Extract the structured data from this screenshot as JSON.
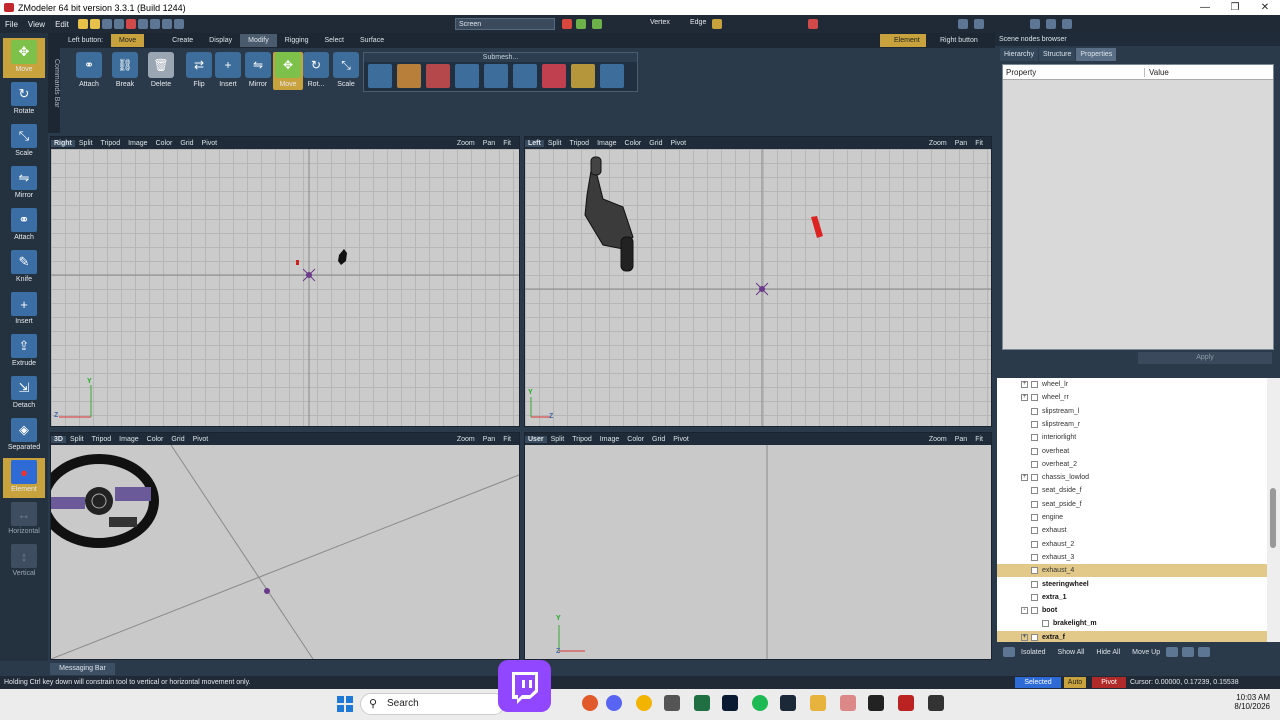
{
  "window": {
    "title": "ZModeler 64 bit version 3.3.1 (Build 1244)"
  },
  "menu": [
    "File",
    "View",
    "Edit"
  ],
  "toolbar": {
    "screen_dropdown": "Screen",
    "vertex": "Vertex",
    "edge": "Edge",
    "left_button_label": "Left button:",
    "left_button_value": "Move",
    "element_label": "Element",
    "right_button_label": "Right button"
  },
  "left_tools": [
    {
      "label": "Move",
      "icon": "move-icon",
      "active": true
    },
    {
      "label": "Rotate",
      "icon": "rotate-icon"
    },
    {
      "label": "Scale",
      "icon": "scale-icon"
    },
    {
      "label": "Mirror",
      "icon": "mirror-icon"
    },
    {
      "label": "Attach",
      "icon": "attach-icon"
    },
    {
      "label": "Knife",
      "icon": "knife-icon"
    },
    {
      "label": "Insert",
      "icon": "insert-icon"
    },
    {
      "label": "Extrude",
      "icon": "extrude-icon"
    },
    {
      "label": "Detach",
      "icon": "detach-icon"
    },
    {
      "label": "Separated",
      "icon": "separated-icon"
    },
    {
      "label": "Element",
      "icon": "element-icon",
      "active": true
    },
    {
      "label": "Horizontal",
      "icon": "horizontal-icon",
      "disabled": true
    },
    {
      "label": "Vertical",
      "icon": "vertical-icon",
      "disabled": true
    }
  ],
  "commands_bar": "Commands Bar",
  "ribbon_tabs": [
    "Create",
    "Display",
    "Modify",
    "Rigging",
    "Select",
    "Surface"
  ],
  "ribbon_active_tab": "Modify",
  "ribbon_buttons": [
    {
      "label": "Attach",
      "icon": "attach-icon"
    },
    {
      "label": "Break",
      "icon": "break-icon"
    },
    {
      "label": "Delete",
      "icon": "trash-icon"
    },
    {
      "label": "Flip",
      "icon": "flip-icon"
    },
    {
      "label": "Insert",
      "icon": "insert-icon"
    },
    {
      "label": "Mirror",
      "icon": "mirror-icon"
    },
    {
      "label": "Move",
      "icon": "move-icon",
      "active": true
    },
    {
      "label": "Rot...",
      "icon": "rotate-icon"
    },
    {
      "label": "Scale",
      "icon": "scale-icon"
    }
  ],
  "submesh_title": "Submesh...",
  "viewports": [
    {
      "name": "Right",
      "menu": [
        "Split",
        "Tripod",
        "Image",
        "Color",
        "Grid",
        "Pivot"
      ],
      "right": [
        "Zoom",
        "Pan",
        "Fit"
      ],
      "axes": [
        "Y",
        "Z"
      ]
    },
    {
      "name": "Left",
      "menu": [
        "Split",
        "Tripod",
        "Image",
        "Color",
        "Grid",
        "Pivot"
      ],
      "right": [
        "Zoom",
        "Pan",
        "Fit"
      ],
      "axes": [
        "Y",
        "Z"
      ]
    },
    {
      "name": "3D",
      "menu": [
        "Split",
        "Tripod",
        "Image",
        "Color",
        "Grid",
        "Pivot"
      ],
      "right": [
        "Zoom",
        "Pan",
        "Fit"
      ]
    },
    {
      "name": "User",
      "menu": [
        "Split",
        "Tripod",
        "Image",
        "Color",
        "Grid",
        "Pivot"
      ],
      "right": [
        "Zoom",
        "Pan",
        "Fit"
      ],
      "axes": [
        "Y",
        "Z"
      ]
    }
  ],
  "scene_browser": {
    "title": "Scene nodes browser",
    "tabs": [
      "Hierarchy",
      "Structure",
      "Properties"
    ],
    "active_tab": "Properties",
    "columns": [
      "Property",
      "Value"
    ],
    "apply": "Apply"
  },
  "tree_nodes": [
    {
      "label": "wheel_lr",
      "expander": "+"
    },
    {
      "label": "wheel_rr",
      "expander": "+"
    },
    {
      "label": "slipstream_l"
    },
    {
      "label": "slipstream_r"
    },
    {
      "label": "interiorlight"
    },
    {
      "label": "overheat"
    },
    {
      "label": "overheat_2"
    },
    {
      "label": "chassis_lowlod",
      "expander": "+"
    },
    {
      "label": "seat_dside_f"
    },
    {
      "label": "seat_pside_f"
    },
    {
      "label": "engine"
    },
    {
      "label": "exhaust"
    },
    {
      "label": "exhaust_2"
    },
    {
      "label": "exhaust_3"
    },
    {
      "label": "exhaust_4",
      "selected": true
    },
    {
      "label": "steeringwheel",
      "bold": true
    },
    {
      "label": "extra_1",
      "bold": true
    },
    {
      "label": "boot",
      "bold": true,
      "expander": "-"
    },
    {
      "label": "brakelight_m",
      "bold": true,
      "indent": 1
    },
    {
      "label": "extra_f",
      "bold": true,
      "selected": true,
      "expander": "+"
    }
  ],
  "tree_bar": [
    "Isolated",
    "Show All",
    "Hide All",
    "Move Up"
  ],
  "messaging_bar": "Messaging Bar",
  "status": {
    "hint": "Holding Ctrl key down will constrain tool to vertical or horizontal movement only.",
    "selected": "Selected",
    "auto": "Auto",
    "pivot": "Pivot",
    "cursor": "Cursor: 0.00000, 0.17239, 0.15538"
  },
  "taskbar": {
    "search": "Search",
    "time": "10:03 AM",
    "date": "8/10/2026"
  },
  "colors": {
    "accent": "#c8a23c",
    "panel": "#2b3a4a",
    "viewport": "#cbcbcb",
    "selected_row": "#e2c98a"
  }
}
